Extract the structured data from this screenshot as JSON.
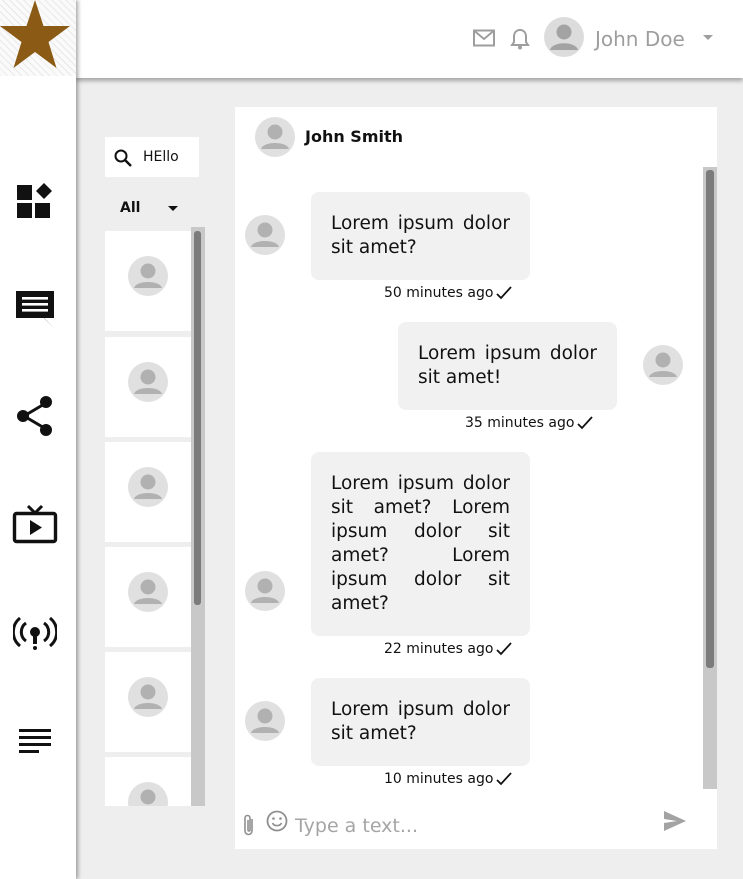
{
  "sidebar": {
    "logo_icon": "star-icon",
    "items": [
      {
        "icon": "dashboard-widgets-icon"
      },
      {
        "icon": "chat-message-icon"
      },
      {
        "icon": "share-icon"
      },
      {
        "icon": "live-tv-icon"
      },
      {
        "icon": "broadcast-icon"
      },
      {
        "icon": "notes-lines-icon"
      }
    ]
  },
  "header": {
    "mail_icon": "mail-icon",
    "bell_icon": "bell-icon",
    "user_name": "John Doe"
  },
  "conversations": {
    "search_value": "HEllo",
    "filter_label": "All",
    "item_count": 6
  },
  "chat": {
    "contact_name": "John Smith",
    "messages": [
      {
        "side": "left",
        "text": "Lorem ipsum dolor sit amet?",
        "time": "50 minutes ago"
      },
      {
        "side": "right",
        "text": "Lorem ipsum dolor sit amet!",
        "time": "35 minutes ago"
      },
      {
        "side": "left",
        "text": "Lorem ipsum dolor sit amet? Lorem ipsum dolor sit amet? Lorem ipsum dolor sit amet?",
        "time": "22 minutes ago"
      },
      {
        "side": "left",
        "text": "Lorem ipsum dolor sit amet?",
        "time": "10 minutes ago"
      }
    ],
    "composer": {
      "placeholder": "Type a text..."
    }
  },
  "colors": {
    "logo_star": "#8b5a14",
    "bubble": "#f1f1f1",
    "background": "#eeeeee"
  }
}
